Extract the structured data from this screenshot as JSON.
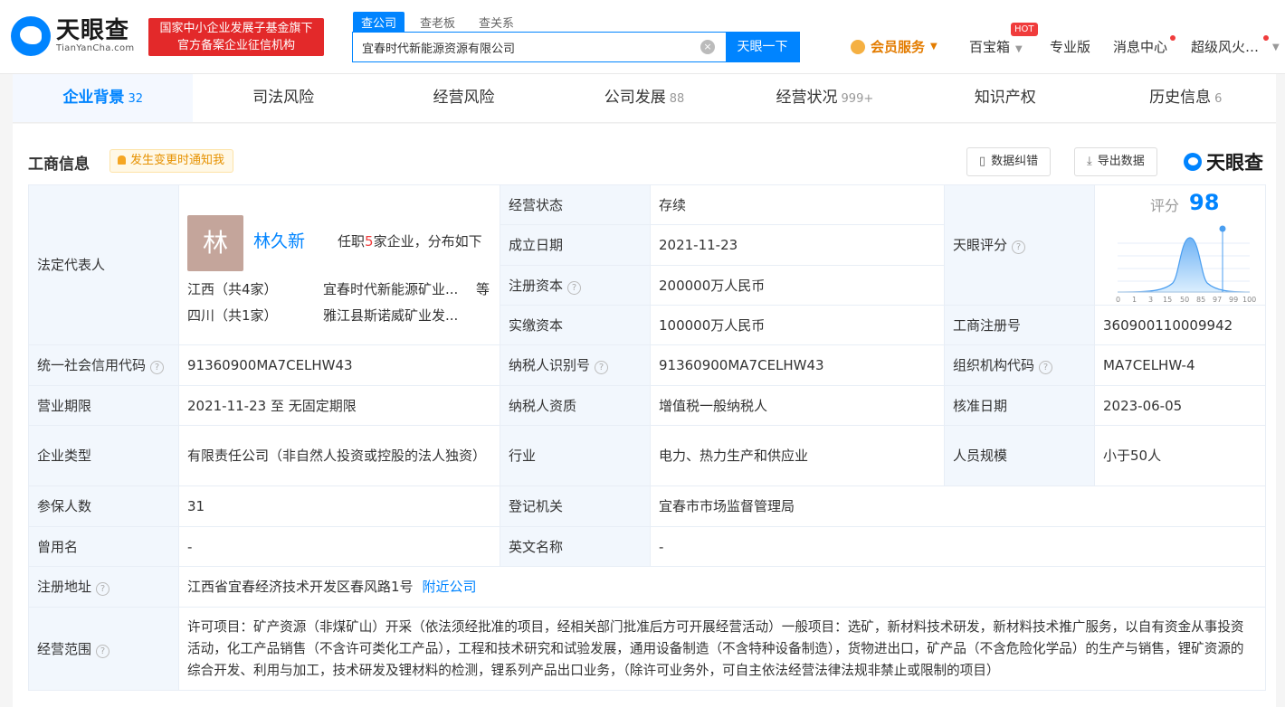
{
  "header": {
    "logo_cn": "天眼查",
    "logo_en": "TianYanCha.com",
    "badge_line1": "国家中小企业发展子基金旗下",
    "badge_line2": "官方备案企业征信机构",
    "search_tabs": [
      "查公司",
      "查老板",
      "查关系"
    ],
    "search_value": "宜春时代新能源资源有限公司",
    "search_button": "天眼一下",
    "nav": {
      "vip": "会员服务",
      "treasure": "百宝箱",
      "hot": "HOT",
      "pro": "专业版",
      "messages": "消息中心",
      "user": "超级风火…"
    }
  },
  "tabs": [
    {
      "label": "企业背景",
      "count": "32"
    },
    {
      "label": "司法风险",
      "count": ""
    },
    {
      "label": "经营风险",
      "count": ""
    },
    {
      "label": "公司发展",
      "count": "88"
    },
    {
      "label": "经营状况",
      "count": "999+"
    },
    {
      "label": "知识产权",
      "count": ""
    },
    {
      "label": "历史信息",
      "count": "6"
    }
  ],
  "section": {
    "title": "工商信息",
    "notify": "发生变更时通知我",
    "correct_btn": "数据纠错",
    "export_btn": "导出数据",
    "brand": "天眼查"
  },
  "legal": {
    "label": "法定代表人",
    "avatar": "林",
    "name": "林久新",
    "count_pre": "任职",
    "count_num": "5",
    "count_post": "家企业，分布如下",
    "regions": [
      {
        "region": "江西（共4家）",
        "company": "宜春时代新能源矿业...",
        "etc": "等"
      },
      {
        "region": "四川（共1家）",
        "company": "雅江县斯诺威矿业发...",
        "etc": ""
      }
    ]
  },
  "score": {
    "label": "天眼评分",
    "title": "评分",
    "value": "98",
    "ticks": [
      "0",
      "1",
      "3",
      "15",
      "50",
      "85",
      "97",
      "99",
      "100"
    ]
  },
  "fields": {
    "status_l": "经营状态",
    "status_v": "存续",
    "found_l": "成立日期",
    "found_v": "2021-11-23",
    "regcap_l": "注册资本",
    "regcap_v": "200000万人民币",
    "paidcap_l": "实缴资本",
    "paidcap_v": "100000万人民币",
    "regno_l": "工商注册号",
    "regno_v": "360900110009942",
    "credit_l": "统一社会信用代码",
    "credit_v": "91360900MA7CELHW43",
    "taxid_l": "纳税人识别号",
    "taxid_v": "91360900MA7CELHW43",
    "org_l": "组织机构代码",
    "org_v": "MA7CELHW-4",
    "term_l": "营业期限",
    "term_v": "2021-11-23 至 无固定期限",
    "taxq_l": "纳税人资质",
    "taxq_v": "增值税一般纳税人",
    "approve_l": "核准日期",
    "approve_v": "2023-06-05",
    "type_l": "企业类型",
    "type_v": "有限责任公司（非自然人投资或控股的法人独资）",
    "industry_l": "行业",
    "industry_v": "电力、热力生产和供应业",
    "staff_l": "人员规模",
    "staff_v": "小于50人",
    "insured_l": "参保人数",
    "insured_v": "31",
    "authority_l": "登记机关",
    "authority_v": "宜春市市场监督管理局",
    "former_l": "曾用名",
    "former_v": "-",
    "english_l": "英文名称",
    "english_v": "-",
    "addr_l": "注册地址",
    "addr_v": "江西省宜春经济技术开发区春风路1号",
    "addr_link": "附近公司",
    "scope_l": "经营范围",
    "scope_v": "许可项目：矿产资源（非煤矿山）开采（依法须经批准的项目，经相关部门批准后方可开展经营活动）一般项目：选矿，新材料技术研发，新材料技术推广服务，以自有资金从事投资活动，化工产品销售（不含许可类化工产品），工程和技术研究和试验发展，通用设备制造（不含特种设备制造），货物进出口，矿产品（不含危险化学品）的生产与销售，锂矿资源的综合开发、利用与加工，技术研发及锂材料的检测，锂系列产品出口业务，（除许可业务外，可自主依法经营法律法规非禁止或限制的项目）"
  }
}
